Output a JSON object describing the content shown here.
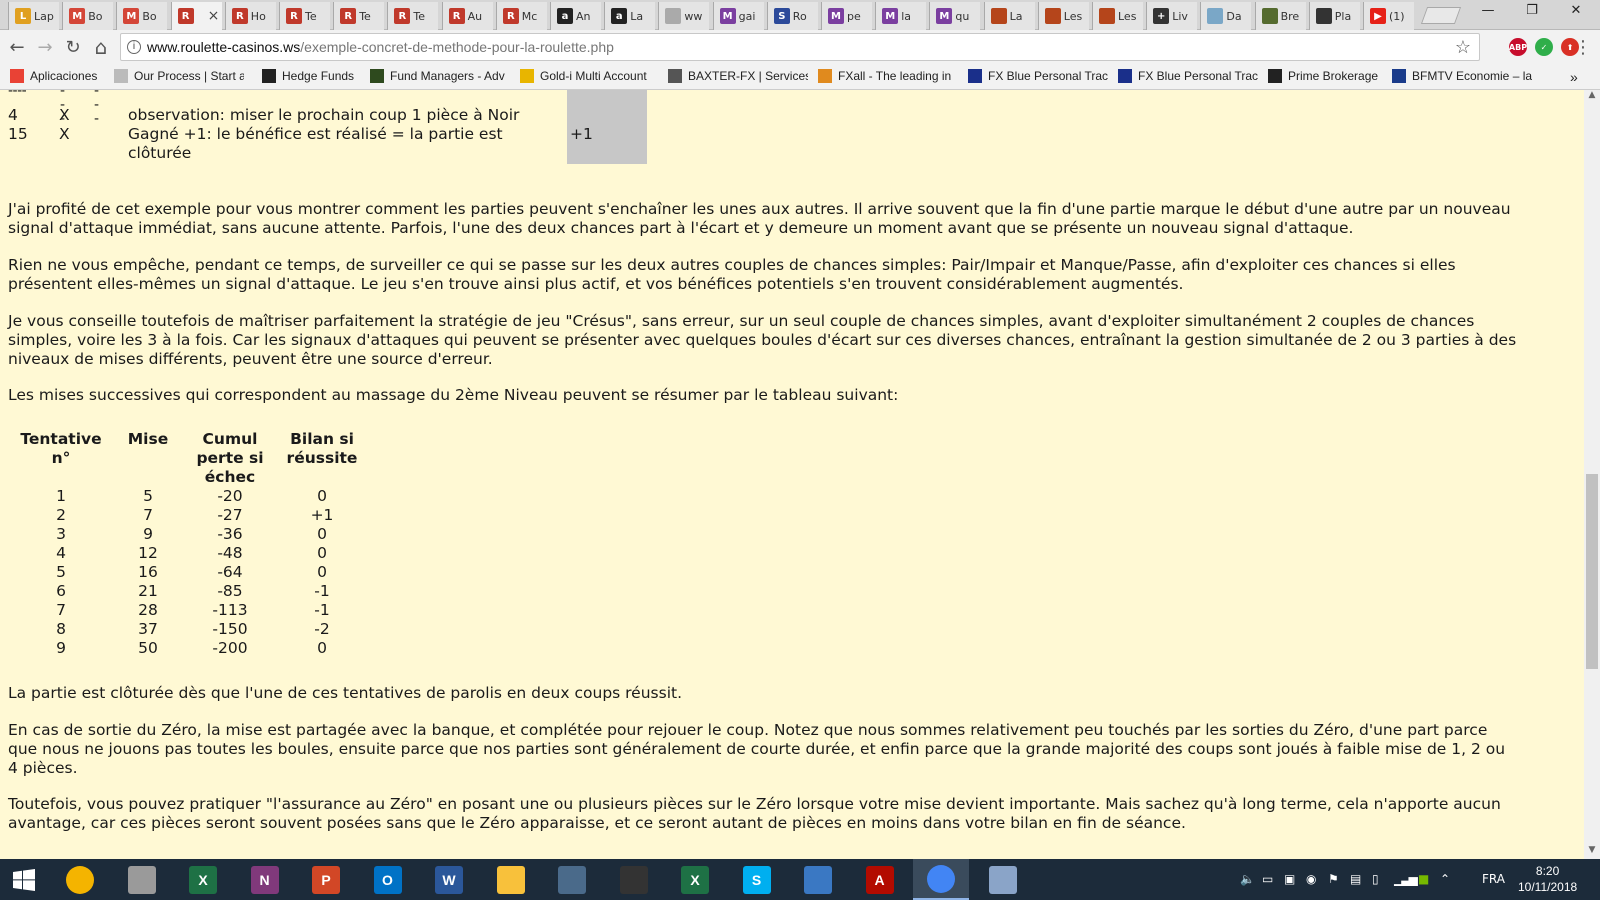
{
  "browser": {
    "tabs": [
      {
        "label": "Lap",
        "color": "#e0a020",
        "letter": "L"
      },
      {
        "label": "Bo",
        "color": "#d44638",
        "letter": "M"
      },
      {
        "label": "Bo",
        "color": "#d44638",
        "letter": "M"
      },
      {
        "label": "",
        "color": "#c0392b",
        "letter": "R",
        "active": true
      },
      {
        "label": "Ho",
        "color": "#c0392b",
        "letter": "R"
      },
      {
        "label": "Te",
        "color": "#c0392b",
        "letter": "R"
      },
      {
        "label": "Te",
        "color": "#c0392b",
        "letter": "R"
      },
      {
        "label": "Te",
        "color": "#c0392b",
        "letter": "R"
      },
      {
        "label": "Au",
        "color": "#c0392b",
        "letter": "R"
      },
      {
        "label": "Mc",
        "color": "#c0392b",
        "letter": "R"
      },
      {
        "label": "An",
        "color": "#222222",
        "letter": "a"
      },
      {
        "label": "La",
        "color": "#222222",
        "letter": "a"
      },
      {
        "label": "ww",
        "color": "#aaaaaa",
        "letter": ""
      },
      {
        "label": "gai",
        "color": "#7b3fa0",
        "letter": "M"
      },
      {
        "label": "Ro",
        "color": "#2c4a9a",
        "letter": "S"
      },
      {
        "label": "pe",
        "color": "#7b3fa0",
        "letter": "M"
      },
      {
        "label": "la",
        "color": "#7b3fa0",
        "letter": "M"
      },
      {
        "label": "qu",
        "color": "#7b3fa0",
        "letter": "M"
      },
      {
        "label": "La",
        "color": "#b5451b",
        "letter": ""
      },
      {
        "label": "Les",
        "color": "#b5451b",
        "letter": ""
      },
      {
        "label": "Les",
        "color": "#b5451b",
        "letter": ""
      },
      {
        "label": "Liv",
        "color": "#333333",
        "letter": "+"
      },
      {
        "label": "Da",
        "color": "#7aa7c7",
        "letter": ""
      },
      {
        "label": "Bre",
        "color": "#556b2f",
        "letter": ""
      },
      {
        "label": "Pla",
        "color": "#333333",
        "letter": ""
      },
      {
        "label": "(1)",
        "color": "#e62117",
        "letter": "▶"
      }
    ],
    "close_glyph": "×",
    "window_controls": {
      "minimize": "—",
      "restore": "❐",
      "close": "✕"
    },
    "url_host": "www.roulette-casinos.ws",
    "url_path": "/exemple-concret-de-methode-pour-la-roulette.php",
    "nav_icons": {
      "back": "←",
      "forward": "→",
      "reload": "↻",
      "home": "⌂"
    },
    "star_glyph": "☆",
    "extensions": [
      {
        "name": "adblock-icon",
        "label": "ABP",
        "color": "#c70d2c"
      },
      {
        "name": "check-extension-icon",
        "label": "✓",
        "color": "#2fae4a"
      },
      {
        "name": "upload-extension-icon",
        "label": "⬆",
        "color": "#d93025"
      }
    ],
    "menu_glyph": "⋮",
    "bookmarks": [
      {
        "label": "Aplicaciones",
        "icon": "apps-icon",
        "color": "#e94235"
      },
      {
        "label": "Our Process | Start a",
        "icon": "page-icon",
        "color": "#bbbbbb"
      },
      {
        "label": "Hedge Funds",
        "icon": "sh-icon",
        "color": "#222222"
      },
      {
        "label": "Fund Managers - Adv",
        "icon": "fm-icon",
        "color": "#2e4a1e"
      },
      {
        "label": "Gold-i Multi Account",
        "icon": "gold-icon",
        "color": "#e8b500"
      },
      {
        "label": "BAXTER-FX | Services",
        "icon": "baxter-icon",
        "color": "#555555"
      },
      {
        "label": "FXall - The leading in",
        "icon": "fxall-icon",
        "color": "#e08a1e"
      },
      {
        "label": "FX Blue Personal Trac",
        "icon": "fxblue-icon",
        "color": "#1a2f8a"
      },
      {
        "label": "FX Blue Personal Trac",
        "icon": "fxblue-icon",
        "color": "#1a2f8a"
      },
      {
        "label": "Prime Brokerage",
        "icon": "prime-icon",
        "color": "#222222"
      },
      {
        "label": "BFMTV Economie – la",
        "icon": "bfmtv-icon",
        "color": "#1a3b8a"
      }
    ],
    "more_glyph": "»"
  },
  "page": {
    "top_table": {
      "dashes": [
        "----",
        "---",
        "---"
      ],
      "rows": [
        {
          "num": "4",
          "mark": "X",
          "text": "observation: miser le prochain coup 1 pièce à Noir",
          "result": ""
        },
        {
          "num": "15",
          "mark": "X",
          "text_line1": "Gagné +1: le bénéfice est réalisé = la partie est",
          "text_line2": "clôturée",
          "result": "+1"
        }
      ]
    },
    "paragraphs": [
      {
        "l1": "J'ai profité de cet exemple pour vous montrer comment les parties peuvent s'enchaîner les unes aux autres. Il arrive souvent que la fin d'une partie marque le début d'une autre par un nouveau",
        "l2": "signal d'attaque immédiat, sans aucune attente. Parfois, l'une des deux chances part à l'écart et y demeure un moment avant que se présente un nouveau signal d'attaque."
      },
      {
        "l1": "Rien ne vous empêche, pendant ce temps, de surveiller ce qui se passe sur les deux autres couples de chances simples: Pair/Impair et Manque/Passe, afin d'exploiter ces chances si elles",
        "l2": "présentent elles-mêmes un signal d'attaque. Le jeu s'en trouve ainsi plus actif, et vos bénéfices potentiels s'en trouvent considérablement augmentés."
      },
      {
        "l1": "Je vous conseille toutefois de maîtriser parfaitement la stratégie de jeu \"Crésus\", sans erreur, sur un seul couple de chances simples, avant d'exploiter simultanément 2 couples de chances",
        "l2": "simples, voire les 3 à la fois. Car les signaux d'attaques qui peuvent se présenter avec quelques boules d'écart sur ces diverses chances, entraînant la gestion simultanée de 2 ou 3 parties à des",
        "l3": "niveaux de mises différents, peuvent être une source d'erreur."
      },
      {
        "l1": "Les mises successives qui correspondent au massage du 2ème Niveau peuvent se résumer par le tableau suivant:"
      }
    ],
    "mises_table": {
      "headers": [
        {
          "l1": "Tentative n°"
        },
        {
          "l1": "Mise"
        },
        {
          "l1": "Cumul",
          "l2": "perte si",
          "l3": "échec"
        },
        {
          "l1": "Bilan si",
          "l2": "réussite"
        }
      ],
      "rows": [
        [
          "1",
          "5",
          "-20",
          "0"
        ],
        [
          "2",
          "7",
          "-27",
          "+1"
        ],
        [
          "3",
          "9",
          "-36",
          "0"
        ],
        [
          "4",
          "12",
          "-48",
          "0"
        ],
        [
          "5",
          "16",
          "-64",
          "0"
        ],
        [
          "6",
          "21",
          "-85",
          "-1"
        ],
        [
          "7",
          "28",
          "-113",
          "-1"
        ],
        [
          "8",
          "37",
          "-150",
          "-2"
        ],
        [
          "9",
          "50",
          "-200",
          "0"
        ]
      ]
    },
    "after": [
      {
        "l1": "La partie est clôturée dès que l'une de ces tentatives de parolis en deux coups réussit."
      },
      {
        "l1": "En cas de sortie du Zéro, la mise est partagée avec la banque, et complétée pour rejouer le coup. Notez que nous sommes relativement peu touchés par les sorties du Zéro, d'une part parce",
        "l2": "que nous ne jouons pas toutes les boules, ensuite parce que nos parties sont généralement de courte durée, et enfin parce que la grande majorité des coups sont joués à faible mise de 1, 2 ou",
        "l3": "4 pièces."
      },
      {
        "l1": "Toutefois, vous pouvez pratiquer \"l'assurance au Zéro\" en posant une ou plusieurs pièces sur le Zéro lorsque votre mise devient importante. Mais sachez qu'à long terme, cela n'apporte aucun",
        "l2": "avantage, car ces pièces seront souvent posées sans que le Zéro apparaisse, et ce seront autant de pièces en moins dans votre bilan en fin de séance."
      }
    ],
    "background": "#fff9d4"
  },
  "taskbar": {
    "apps": [
      {
        "name": "chrome-canary-icon",
        "label": "",
        "color": "#f4b400"
      },
      {
        "name": "notepad-icon",
        "label": "",
        "color": "#9a9a9a"
      },
      {
        "name": "excel-app-icon",
        "label": "X",
        "color": "#1e7145"
      },
      {
        "name": "onenote-icon",
        "label": "N",
        "color": "#80397b"
      },
      {
        "name": "powerpoint-icon",
        "label": "P",
        "color": "#d24726"
      },
      {
        "name": "outlook-icon",
        "label": "O",
        "color": "#0072c6"
      },
      {
        "name": "word-icon",
        "label": "W",
        "color": "#2b579a"
      },
      {
        "name": "file-explorer-icon",
        "label": "",
        "color": "#f8c13b"
      },
      {
        "name": "owl-app-icon",
        "label": "",
        "color": "#4a6a8a"
      },
      {
        "name": "owl-app-2-icon",
        "label": "",
        "color": "#333333"
      },
      {
        "name": "excel-icon",
        "label": "X",
        "color": "#1e7145"
      },
      {
        "name": "skype-icon",
        "label": "S",
        "color": "#00aff0"
      },
      {
        "name": "network-app-icon",
        "label": "",
        "color": "#3a78c3"
      },
      {
        "name": "acrobat-icon",
        "label": "A",
        "color": "#b30b00"
      },
      {
        "name": "chrome-icon",
        "label": "",
        "color": "#4285f4"
      },
      {
        "name": "paint-icon",
        "label": "",
        "color": "#8aa4c8"
      }
    ],
    "language": "FRA",
    "time": "8:20",
    "date": "10/11/2018"
  }
}
